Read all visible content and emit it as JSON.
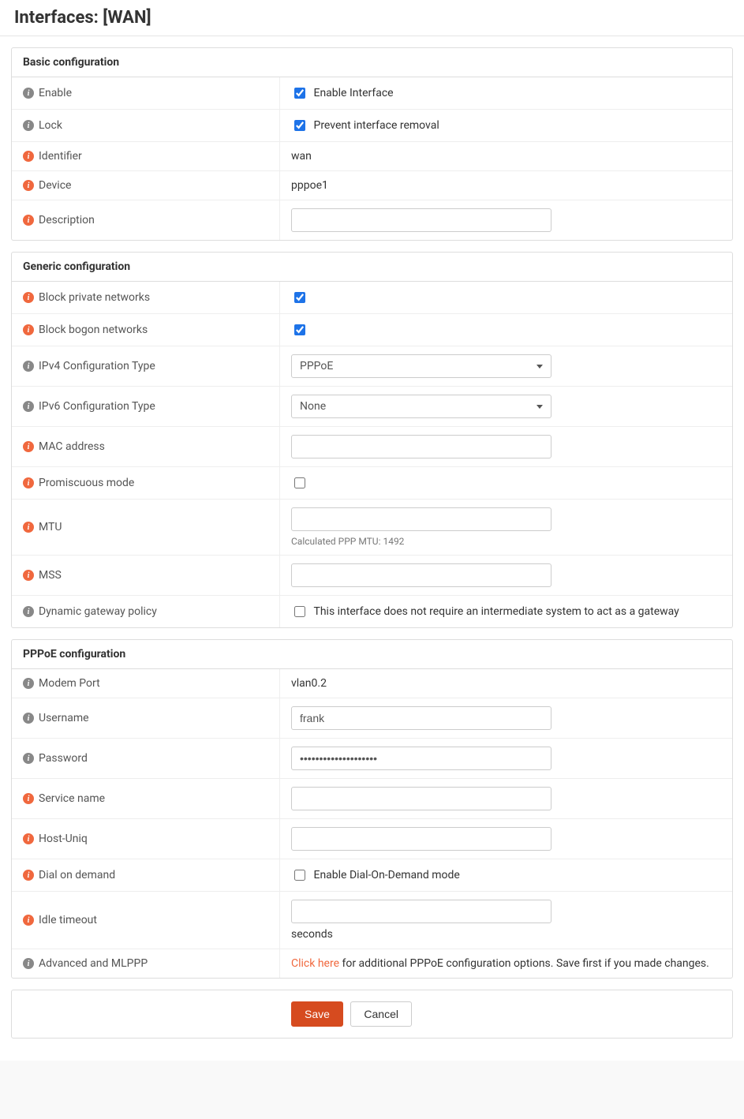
{
  "header": {
    "title": "Interfaces: [WAN]"
  },
  "basic": {
    "heading": "Basic configuration",
    "enable": {
      "label": "Enable",
      "checkbox_label": "Enable Interface",
      "checked": true,
      "icon": "grey"
    },
    "lock": {
      "label": "Lock",
      "checkbox_label": "Prevent interface removal",
      "checked": true,
      "icon": "grey"
    },
    "identifier": {
      "label": "Identifier",
      "value": "wan",
      "icon": "orange"
    },
    "device": {
      "label": "Device",
      "value": "pppoe1",
      "icon": "orange"
    },
    "description": {
      "label": "Description",
      "value": "",
      "icon": "orange"
    }
  },
  "generic": {
    "heading": "Generic configuration",
    "block_private": {
      "label": "Block private networks",
      "checked": true,
      "icon": "orange"
    },
    "block_bogon": {
      "label": "Block bogon networks",
      "checked": true,
      "icon": "orange"
    },
    "ipv4_type": {
      "label": "IPv4 Configuration Type",
      "value": "PPPoE",
      "icon": "grey"
    },
    "ipv6_type": {
      "label": "IPv6 Configuration Type",
      "value": "None",
      "icon": "grey"
    },
    "mac": {
      "label": "MAC address",
      "value": "",
      "icon": "orange"
    },
    "promiscuous": {
      "label": "Promiscuous mode",
      "checked": false,
      "icon": "orange"
    },
    "mtu": {
      "label": "MTU",
      "value": "",
      "help": "Calculated PPP MTU: 1492",
      "icon": "orange"
    },
    "mss": {
      "label": "MSS",
      "value": "",
      "icon": "orange"
    },
    "dyn_gateway": {
      "label": "Dynamic gateway policy",
      "checkbox_label": "This interface does not require an intermediate system to act as a gateway",
      "checked": false,
      "icon": "grey"
    }
  },
  "pppoe": {
    "heading": "PPPoE configuration",
    "modem_port": {
      "label": "Modem Port",
      "value": "vlan0.2",
      "icon": "grey"
    },
    "username": {
      "label": "Username",
      "value": "frank",
      "icon": "grey"
    },
    "password": {
      "label": "Password",
      "value": "••••••••••••••••••••",
      "icon": "grey"
    },
    "service_name": {
      "label": "Service name",
      "value": "",
      "icon": "orange"
    },
    "host_uniq": {
      "label": "Host-Uniq",
      "value": "",
      "icon": "orange"
    },
    "dial_on_demand": {
      "label": "Dial on demand",
      "checkbox_label": "Enable Dial-On-Demand mode",
      "checked": false,
      "icon": "orange"
    },
    "idle_timeout": {
      "label": "Idle timeout",
      "value": "",
      "help": "seconds",
      "icon": "orange"
    },
    "advanced": {
      "label": "Advanced and MLPPP",
      "link_text": "Click here",
      "rest": " for additional PPPoE configuration options. Save first if you made changes.",
      "icon": "grey"
    }
  },
  "footer": {
    "save": "Save",
    "cancel": "Cancel"
  }
}
